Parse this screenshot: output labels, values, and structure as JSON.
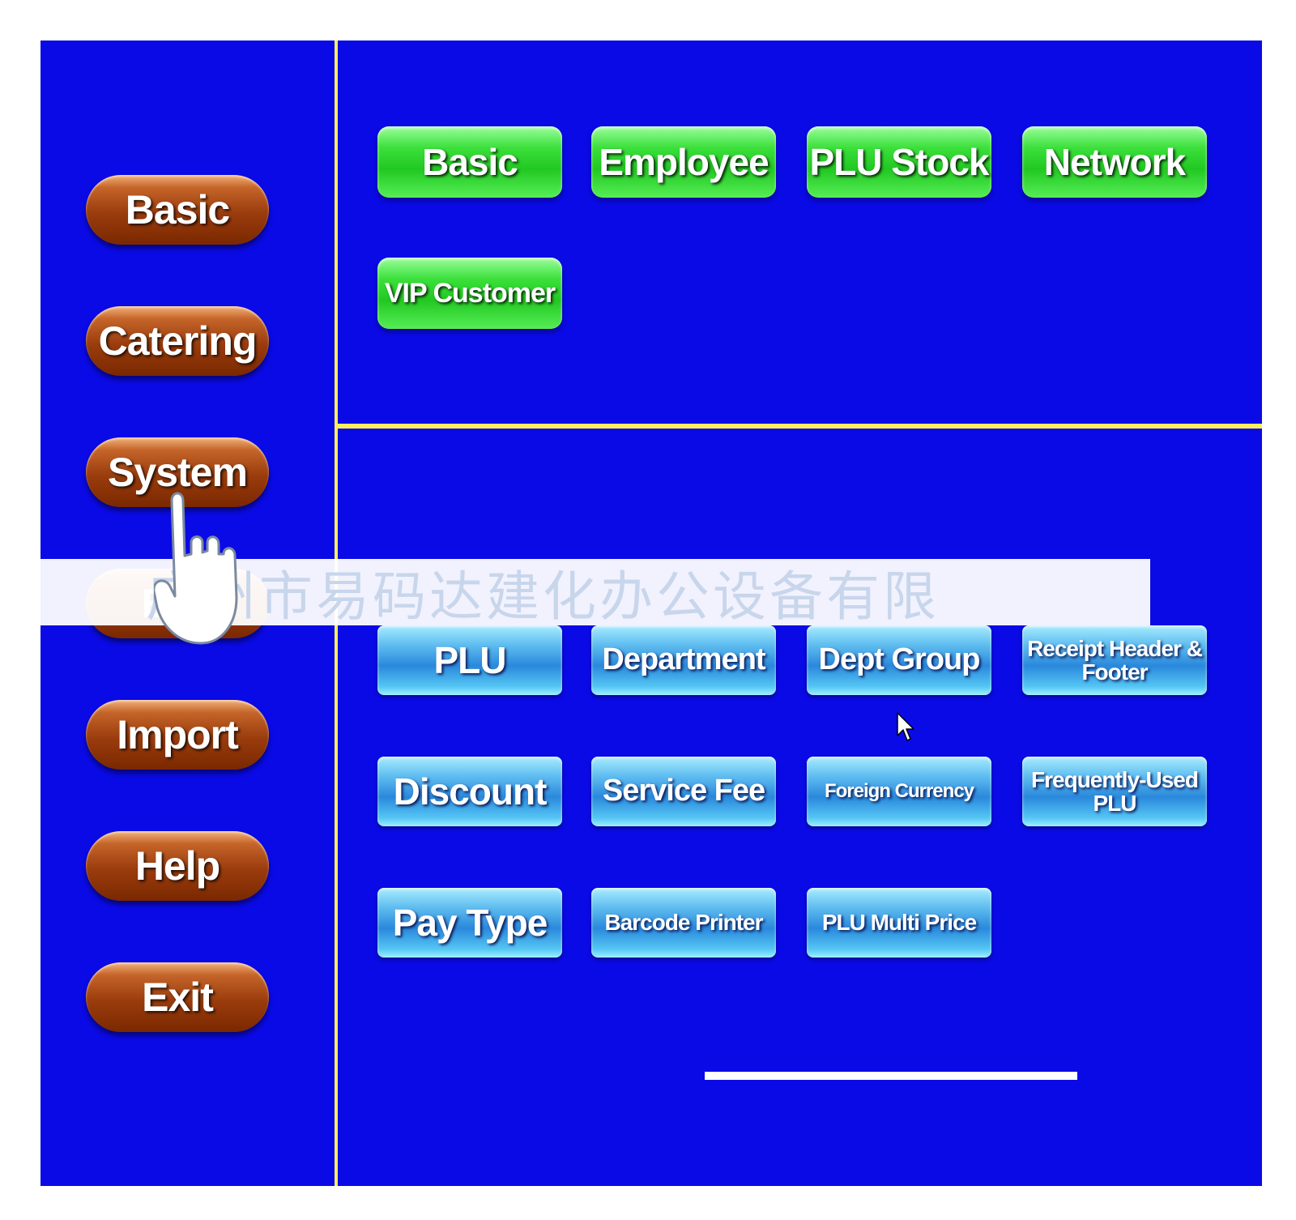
{
  "sidebar": {
    "items": [
      {
        "label": "Basic"
      },
      {
        "label": "Catering"
      },
      {
        "label": "System"
      },
      {
        "label": "Exp"
      },
      {
        "label": "Import"
      },
      {
        "label": "Help"
      },
      {
        "label": "Exit"
      }
    ]
  },
  "top_panel": {
    "buttons": [
      {
        "label": "Basic"
      },
      {
        "label": "Employee"
      },
      {
        "label": "PLU Stock"
      },
      {
        "label": "Network"
      },
      {
        "label": "VIP Customer"
      }
    ]
  },
  "bottom_panel": {
    "buttons": [
      {
        "label": "PLU"
      },
      {
        "label": "Department"
      },
      {
        "label": "Dept Group"
      },
      {
        "label": "Receipt Header & Footer"
      },
      {
        "label": "Discount"
      },
      {
        "label": "Service Fee"
      },
      {
        "label": "Foreign Currency"
      },
      {
        "label": "Frequently-Used PLU"
      },
      {
        "label": "Pay Type"
      },
      {
        "label": "Barcode Printer"
      },
      {
        "label": "PLU Multi Price"
      }
    ]
  },
  "watermark": {
    "text": "广州市易码达建化办公设备有限"
  },
  "colors": {
    "background": "#0a0ae6",
    "divider": "#ffef5a",
    "sidebar_button": "#9a3c0d",
    "top_button": "#22c822",
    "bottom_button": "#2a88dc"
  },
  "icons": [
    "pointing-hand-icon",
    "mouse-cursor-icon"
  ]
}
